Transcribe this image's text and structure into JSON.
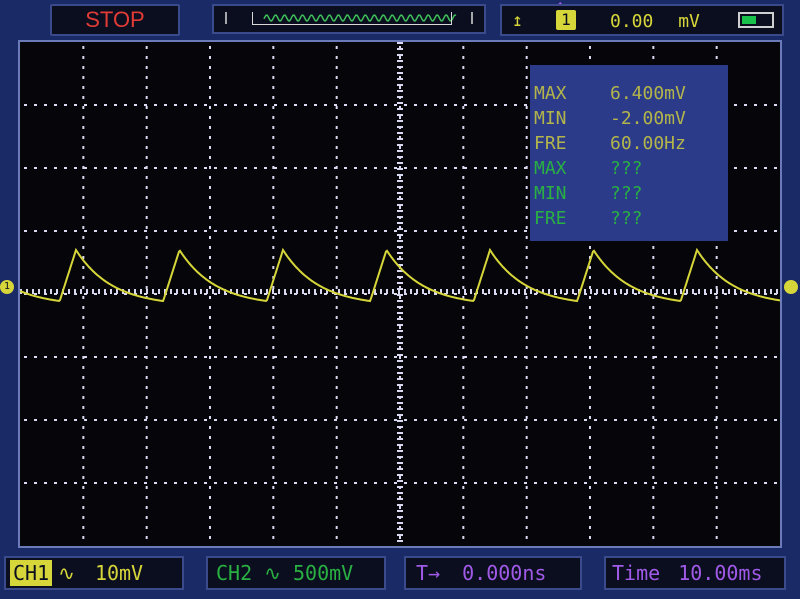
{
  "status": {
    "run_state": "STOP"
  },
  "trigger": {
    "edge_icon": "rising-edge-icon",
    "source": "1",
    "level": "0.00",
    "level_unit": "mV"
  },
  "battery": {
    "color": "#19c24a"
  },
  "measurements": {
    "ch1": [
      {
        "label": "MAX",
        "value": "6.400mV"
      },
      {
        "label": "MIN",
        "value": "-2.00mV"
      },
      {
        "label": "FRE",
        "value": "60.00Hz"
      }
    ],
    "ch2": [
      {
        "label": "MAX",
        "value": "???"
      },
      {
        "label": "MIN",
        "value": "???"
      },
      {
        "label": "FRE",
        "value": "???"
      }
    ]
  },
  "channel1": {
    "tag": "CH1",
    "coupling_icon": "ac-coupling-icon",
    "volts_div": "10mV",
    "color": "#d6d63a"
  },
  "channel2": {
    "label": "CH2",
    "coupling_icon": "ac-coupling-icon",
    "volts_div": "500mV",
    "color": "#29b043"
  },
  "time_offset": {
    "label": "T→",
    "value": "0.000ns"
  },
  "time_base": {
    "label": "Time",
    "value": "10.00ms"
  },
  "colors": {
    "trace": "#d6d63a",
    "grid": "#d8d8f0",
    "accent": "#a15ae8",
    "stop": "#e23b36"
  },
  "ch1_marker": "1"
}
